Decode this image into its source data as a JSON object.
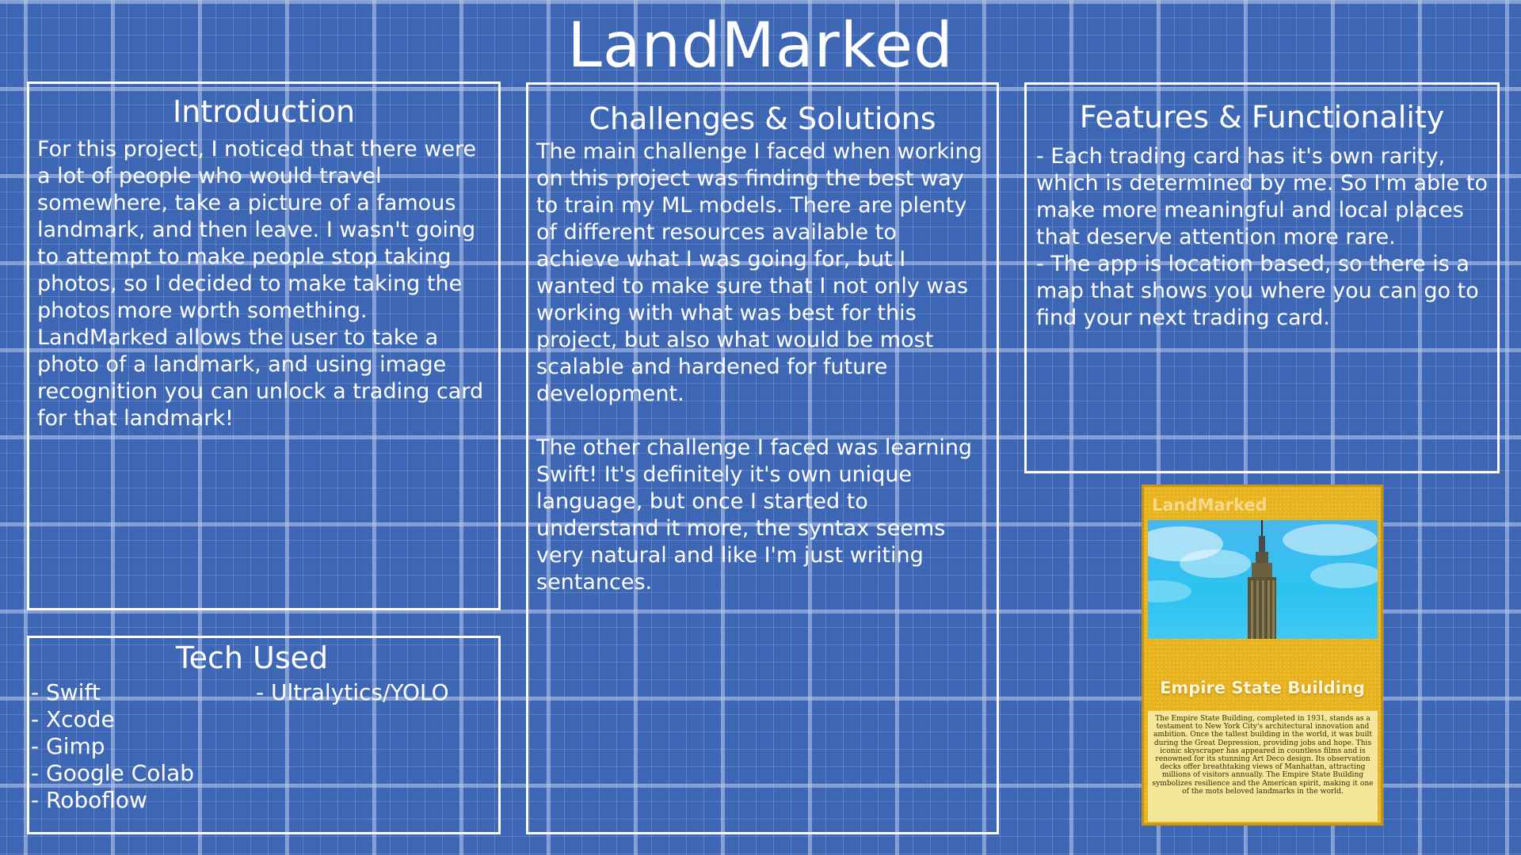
{
  "title": "LandMarked",
  "introduction": {
    "heading": "Introduction",
    "text": "For this project, I noticed that there were\na lot of people who would travel\nsomewhere, take a picture of a famous\nlandmark, and then leave. I wasn't going\nto attempt to make people stop taking\nphotos, so I decided to make taking the\nphotos more worth something.\nLandMarked allows the user to take a\nphoto of a landmark, and using image\nrecognition you can unlock a trading card\nfor that landmark!"
  },
  "challenges": {
    "heading": "Challenges & Solutions",
    "paragraph1": "The main challenge I faced when working\non this project was finding the best way\nto train my ML models. There are plenty\nof different resources available to\nachieve what I was going for, but I\nwanted to make sure that I not only was\nworking with what was best for this\nproject, but also what would be most\nscalable and hardened for future\ndevelopment.",
    "paragraph2": "The other challenge I faced was learning\nSwift! It's definitely it's own unique\nlanguage, but once I started to\nunderstand it more, the syntax seems\nvery natural and like I'm just writing\nsentances."
  },
  "features": {
    "heading": "Features & Functionality",
    "text": "- Each trading card has it's own rarity,\nwhich is determined by me. So I'm able to\nmake more meaningful and local places\nthat deserve attention more rare.\n- The app is location based, so there is a\nmap that shows you where you can go to\nfind your next trading card."
  },
  "tech": {
    "heading": "Tech Used",
    "column1": [
      "- Swift",
      "- Xcode",
      "- Gimp",
      "- Google Colab",
      "- Roboflow"
    ],
    "column2": [
      "- Ultralytics/YOLO"
    ]
  },
  "card": {
    "brand": "LandMarked",
    "name": "Empire State Building",
    "description": "The Empire State Building, completed in 1931, stands as a testament to New York City's architectural innovation and ambition. Once the tallest building in the world, it was built during the Great Depression, providing jobs and hope. This iconic skyscraper has appeared in countless films and is renowned for its stunning Art Deco design. Its observation decks offer breathtaking views of Manhattan, attracting millions of visitors annually. The Empire State Building symbolizes resilience and the American spirit, making it one of the mots beloved landmarks in the world."
  },
  "colors": {
    "background": "#3d67b5",
    "grid": "#baccee",
    "card_gold": "#e7b21c",
    "card_description_bg": "#f5e79a"
  }
}
